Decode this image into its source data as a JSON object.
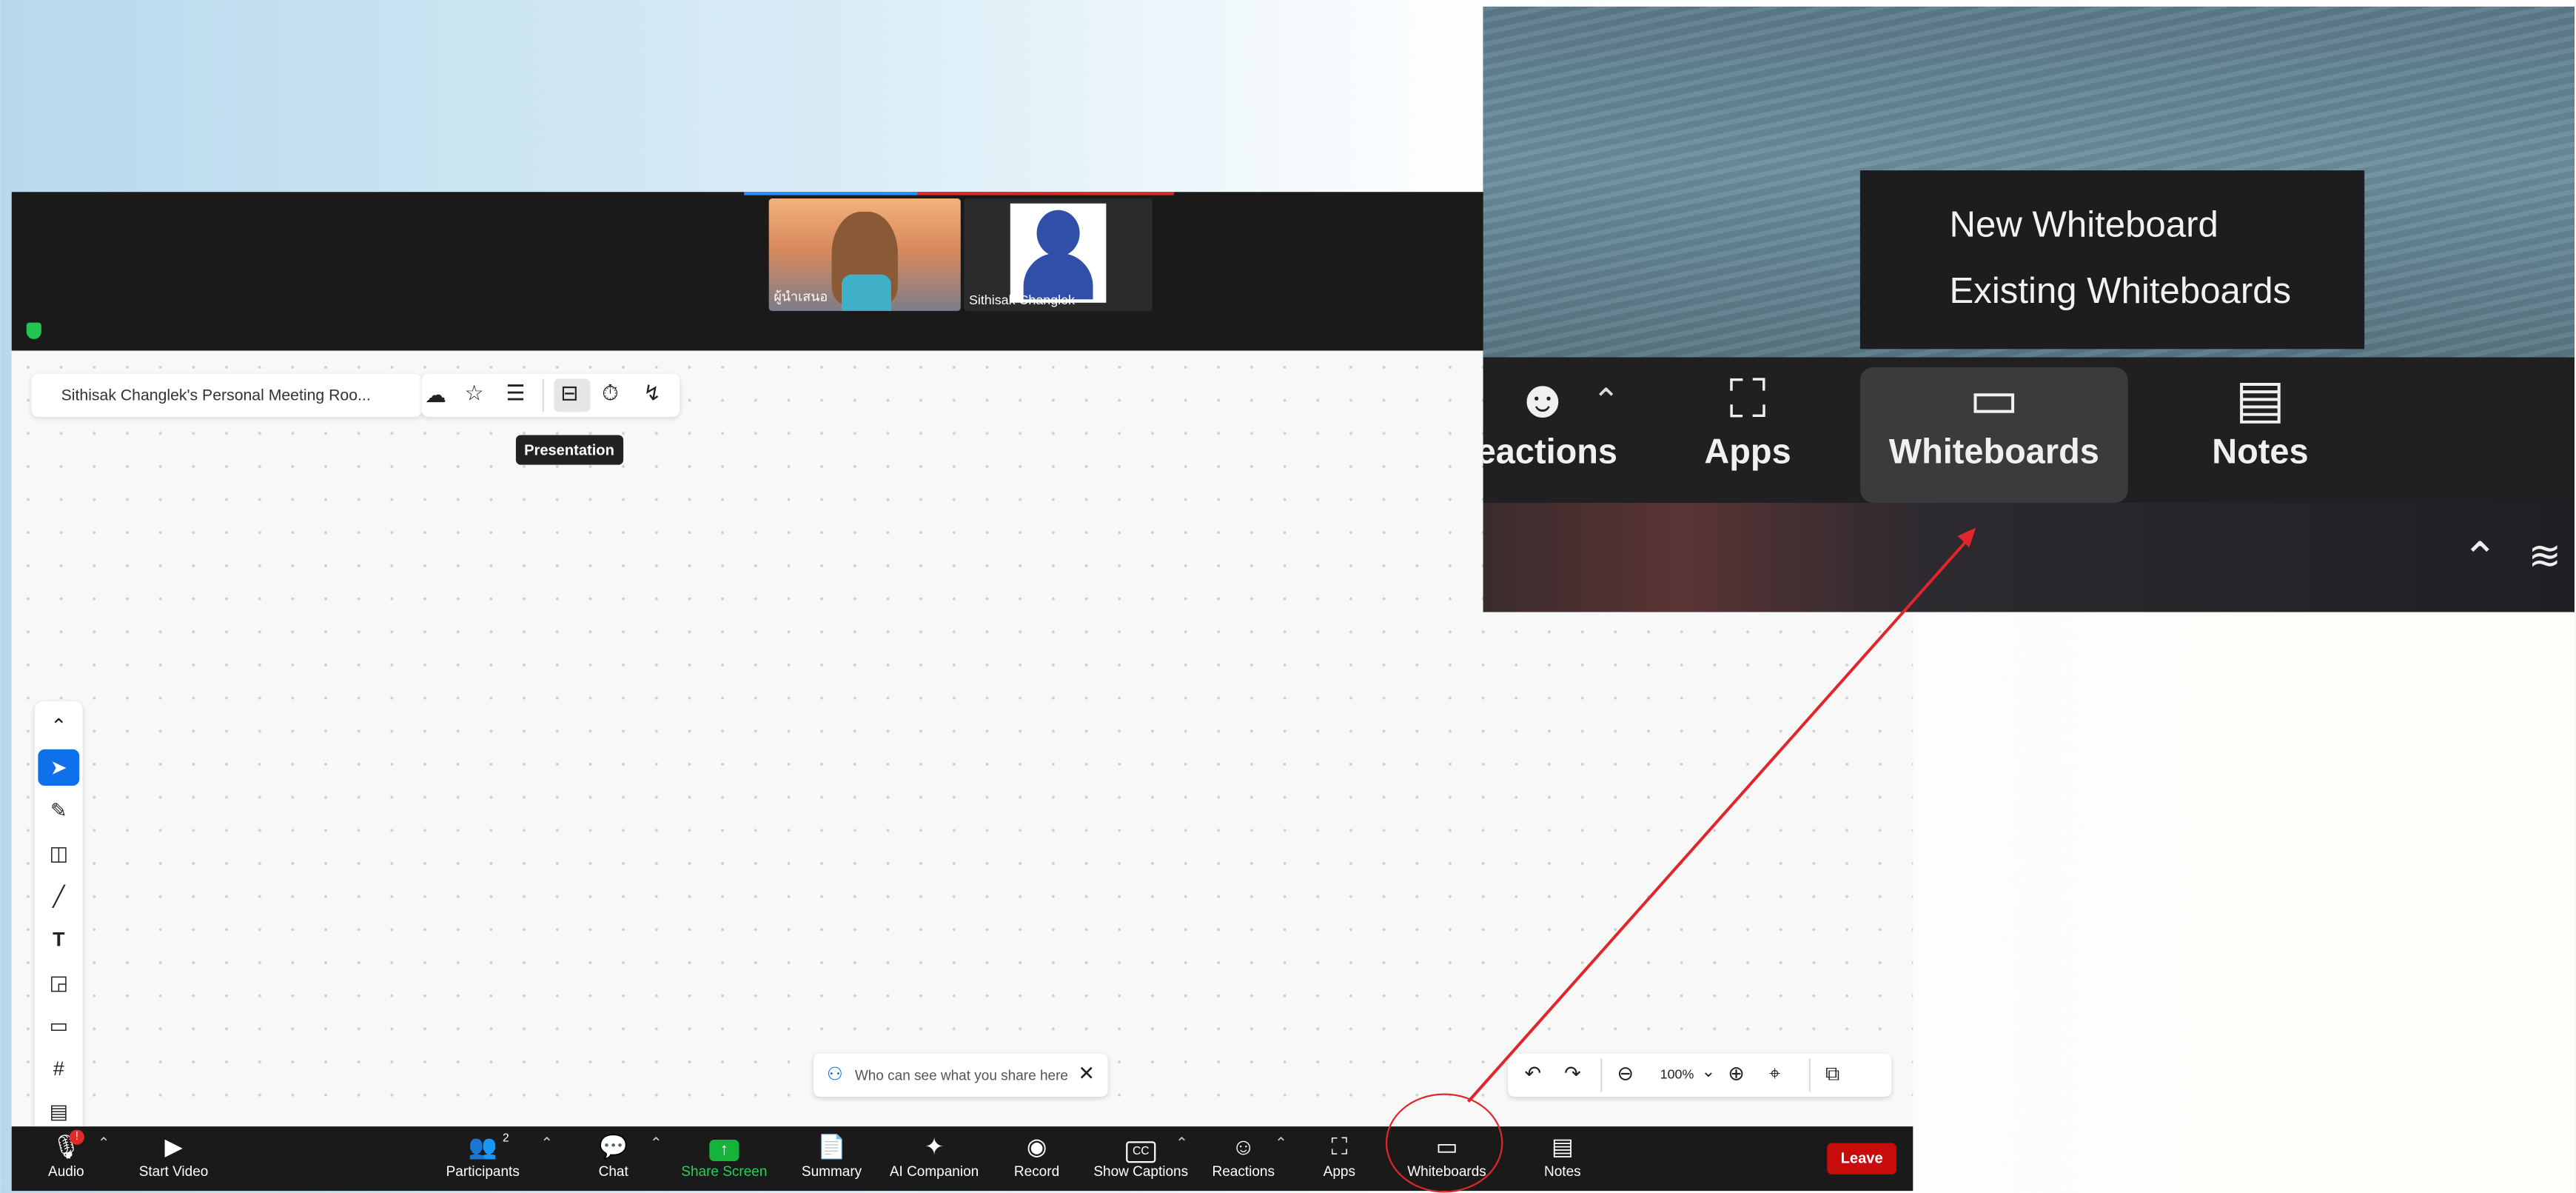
{
  "meeting": {
    "participants_tiles": [
      {
        "name": "ผู้นำเสนอ"
      },
      {
        "name": "Sithisak Changlek"
      }
    ]
  },
  "whiteboard": {
    "title": "Sithisak Changlek's Personal Meeting Roo...",
    "tooltip": "Presentation",
    "share_notice": "Who can see what you share here",
    "zoom_level": "100%"
  },
  "toolbar": {
    "audio": "Audio",
    "audio_badge": "!",
    "start_video": "Start Video",
    "participants": "Participants",
    "participants_count": "2",
    "chat": "Chat",
    "share_screen": "Share Screen",
    "summary": "Summary",
    "ai_companion": "AI Companion",
    "record": "Record",
    "show_captions": "Show Captions",
    "reactions": "Reactions",
    "apps": "Apps",
    "whiteboards": "Whiteboards",
    "notes": "Notes",
    "leave": "Leave"
  },
  "zoom_inset": {
    "menu": [
      "New Whiteboard",
      "Existing Whiteboards"
    ],
    "buttons": {
      "reactions": "eactions",
      "apps": "Apps",
      "whiteboards": "Whiteboards",
      "notes": "Notes"
    }
  },
  "colors": {
    "accent_blue": "#0e71eb",
    "share_green": "#15b33a",
    "leave_red": "#c80b0b",
    "annotation_red": "#e0262b"
  }
}
